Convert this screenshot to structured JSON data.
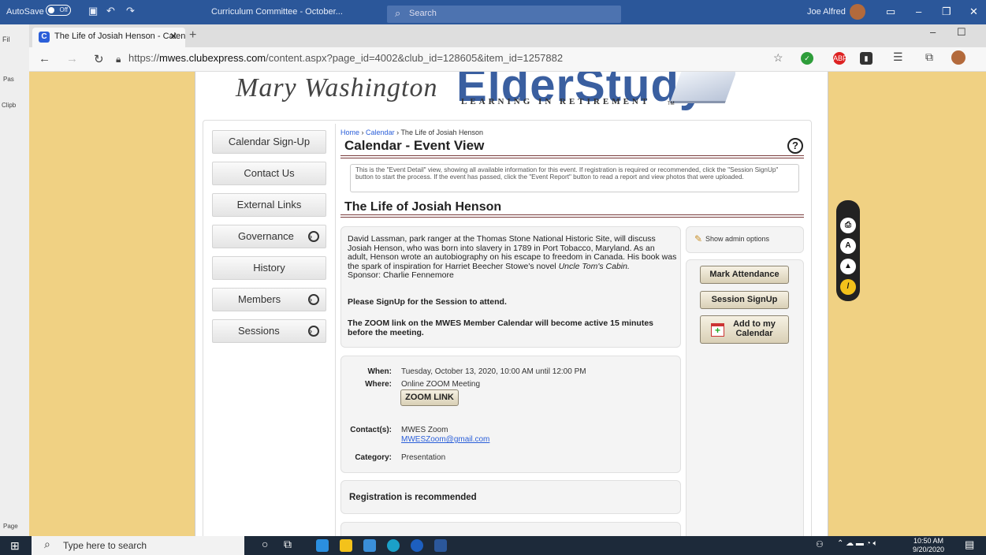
{
  "word": {
    "autosave_label": "AutoSave",
    "autosave_state": "Off",
    "doc_title": "Curriculum Committee - October...",
    "search_placeholder": "Search",
    "user_name": "Joe Alfred",
    "left_labels": [
      "Fil",
      "Pas",
      "Clipb",
      "Page"
    ]
  },
  "browser": {
    "tab_title": "The Life of Josiah Henson - Calen",
    "url_prefix": "https://",
    "url_domain": "mwes.clubexpress.com",
    "url_path": "/content.aspx?page_id=4002&club_id=128605&item_id=1257882"
  },
  "banner": {
    "script_text": "Mary Washington",
    "brand_text": "ElderStudy",
    "tagline": "LEARNING IN RETIREMENT",
    "tm": "TM"
  },
  "menu": {
    "items": [
      {
        "label": "Calendar Sign-Up",
        "has_arrow": false
      },
      {
        "label": "Contact Us",
        "has_arrow": false
      },
      {
        "label": "External Links",
        "has_arrow": false
      },
      {
        "label": "Governance",
        "has_arrow": true
      },
      {
        "label": "History",
        "has_arrow": false
      },
      {
        "label": "Members",
        "has_arrow": true
      },
      {
        "label": "Sessions",
        "has_arrow": true
      }
    ]
  },
  "breadcrumb": {
    "home": "Home",
    "calendar": "Calendar",
    "current": "The Life of Josiah Henson",
    "sep": "›"
  },
  "page_title": "Calendar - Event View",
  "info_text": "This is the \"Event Detail\" view, showing all available information for this event. If registration is required or recommended, click the \"Session SignUp\" button to start the process. If the event has passed, click the \"Event Report\" button to read a report and view photos that were uploaded.",
  "event": {
    "title": "The Life of Josiah Henson",
    "desc_before": "David Lassman, park ranger at the Thomas Stone National Historic Site, will discuss Josiah Henson, who was born into slavery in 1789 in Port Tobacco, Maryland. As an adult, Henson wrote an autobiography on his escape to freedom in Canada. His book was the spark of inspiration for Harriet Beecher Stowe's novel ",
    "desc_book": "Uncle Tom's Cabin.",
    "desc_sponsor": "Sponsor: Charlie Fennemore",
    "signup_note": "Please SignUp for the Session to attend.",
    "zoom_note": "The ZOOM link on the MWES Member Calendar will become active 15 minutes before the meeting.",
    "when_label": "When:",
    "when_value": "Tuesday, October 13, 2020, 10:00 AM until 12:00 PM",
    "where_label": "Where:",
    "where_value": "Online ZOOM Meeting",
    "zoom_button": "ZOOM LINK",
    "contact_label": "Contact(s):",
    "contact_name": "MWES Zoom",
    "contact_email": "MWESZoom@gmail.com",
    "category_label": "Category:",
    "category_value": "Presentation",
    "registration_note": "Registration is recommended"
  },
  "side": {
    "admin_label": "Show admin options",
    "mark_attendance": "Mark Attendance",
    "session_signup": "Session SignUp",
    "add_calendar": "Add to my Calendar"
  },
  "taskbar": {
    "search_placeholder": "Type here to search",
    "time": "10:50 AM",
    "date": "9/20/2020"
  }
}
